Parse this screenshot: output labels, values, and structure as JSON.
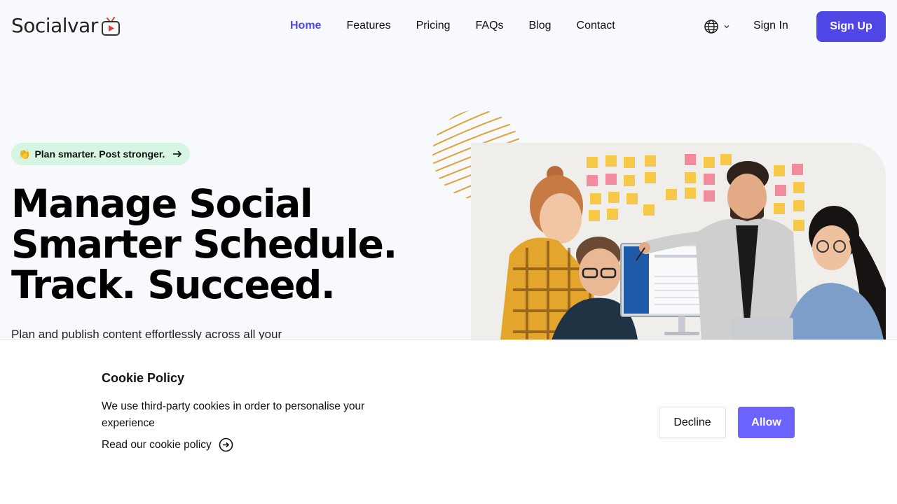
{
  "brand": {
    "name": "Socialvar",
    "accent": "#4f46e5"
  },
  "nav": {
    "items": [
      {
        "label": "Home",
        "active": true
      },
      {
        "label": "Features"
      },
      {
        "label": "Pricing"
      },
      {
        "label": "FAQs"
      },
      {
        "label": "Blog"
      },
      {
        "label": "Contact"
      }
    ],
    "language_icon": "globe-icon",
    "sign_in": "Sign In",
    "sign_up": "Sign Up"
  },
  "hero": {
    "badge": {
      "emoji": "👏",
      "text": "Plan smarter. Post stronger.",
      "icon": "arrow-right-icon"
    },
    "title_lines": [
      "Manage Social",
      "Smarter Schedule.",
      "Track. Succeed."
    ],
    "subtitle": "Plan and publish content effortlessly across all your"
  },
  "cookie": {
    "title": "Cookie Policy",
    "text": "We use third-party cookies in order to personalise your experience",
    "link": "Read our cookie policy",
    "decline": "Decline",
    "allow": "Allow"
  }
}
